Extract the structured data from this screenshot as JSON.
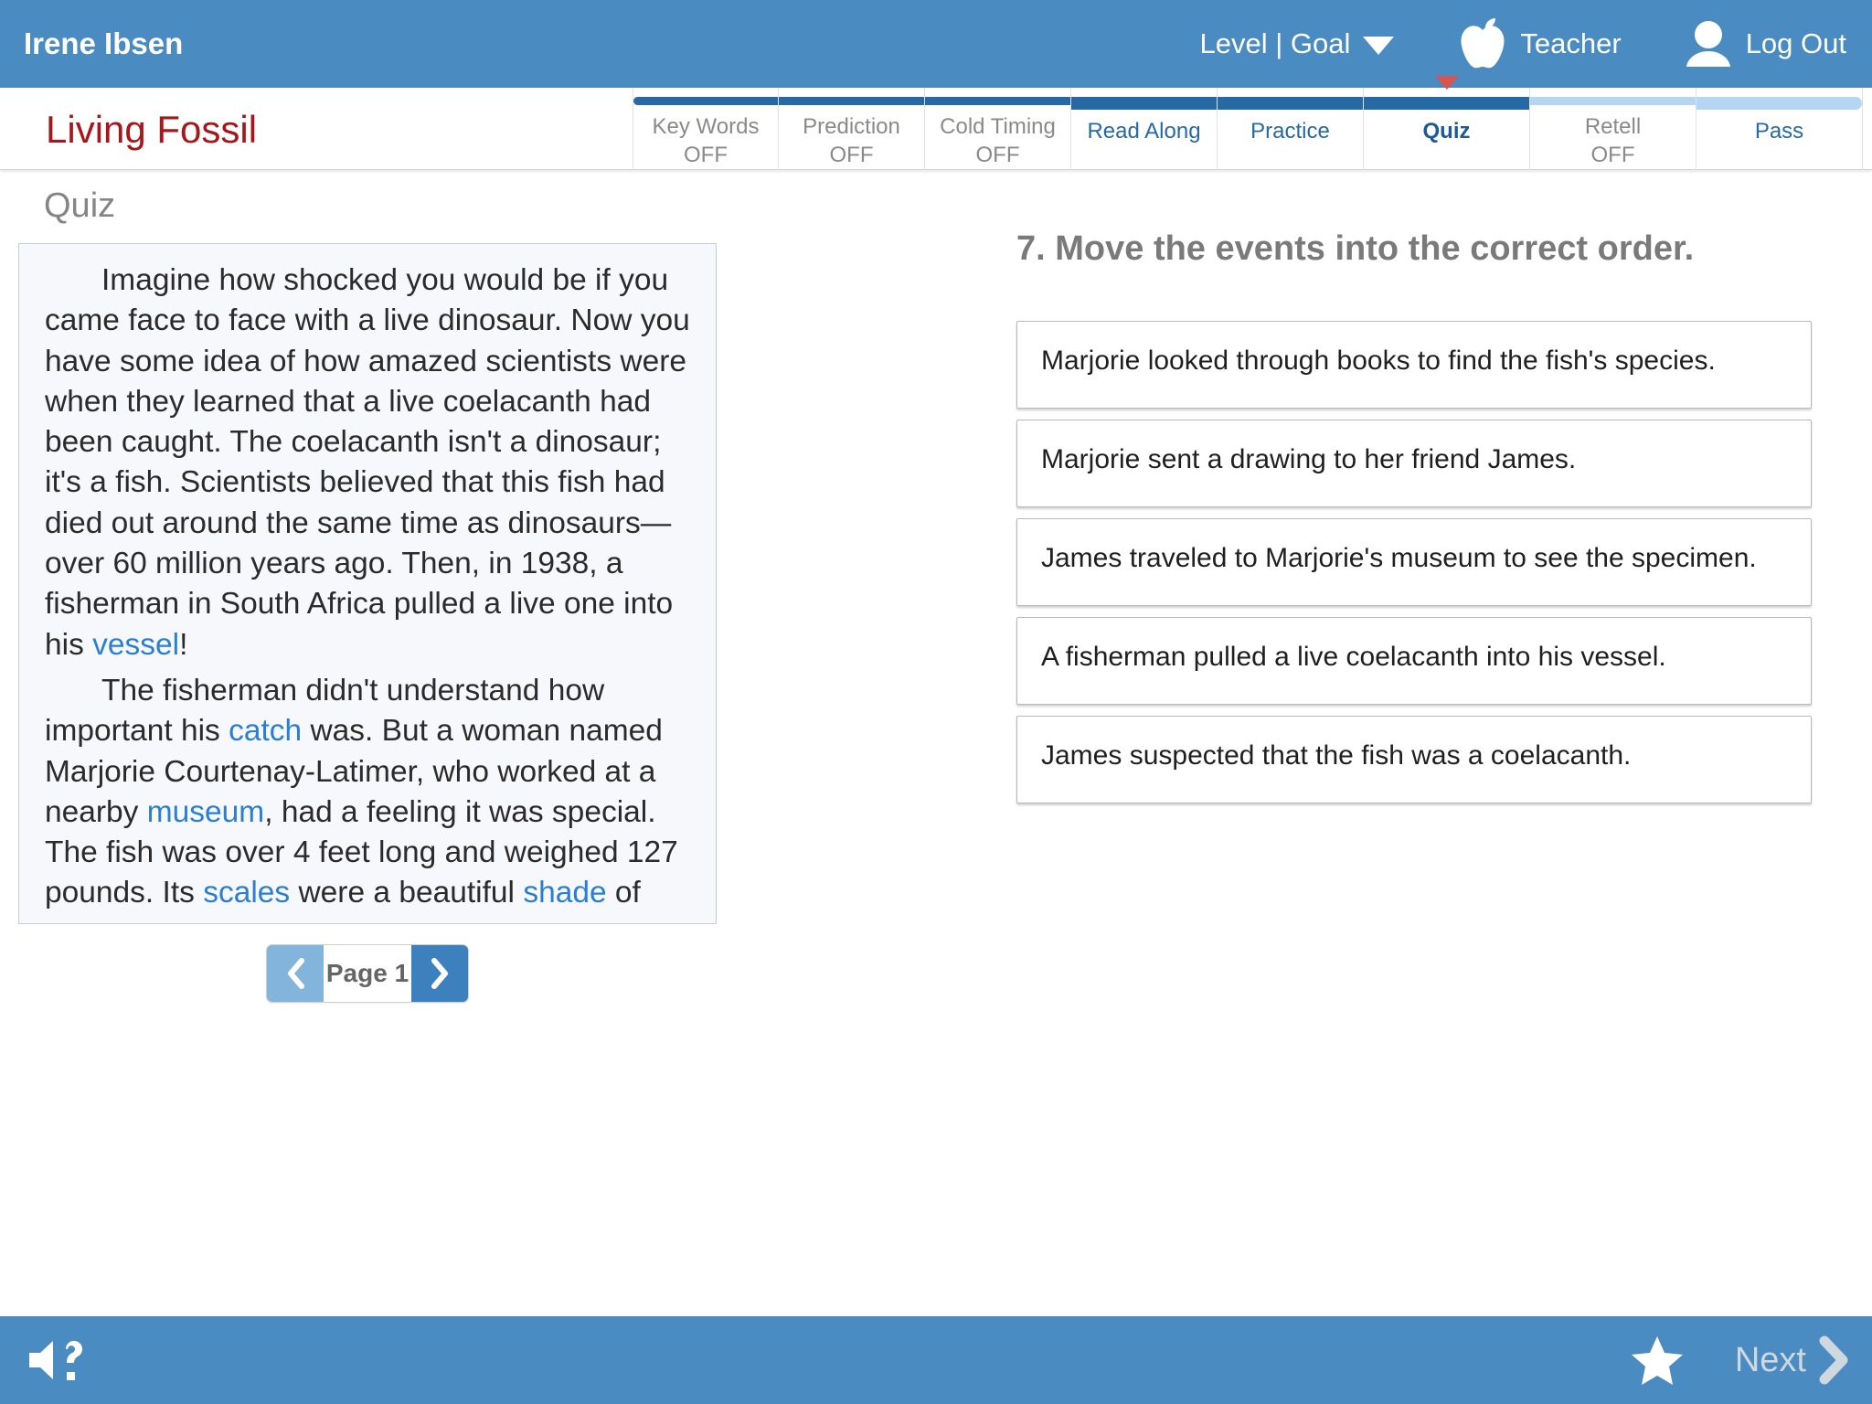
{
  "header": {
    "student_name": "Irene Ibsen",
    "level_goal_label": "Level | Goal",
    "teacher_label": "Teacher",
    "logout_label": "Log Out",
    "accent_color": "#4a8bc2"
  },
  "nav": {
    "book_title": "Living Fossil",
    "title_color": "#a6161b",
    "tabs": [
      {
        "label": "Key Words",
        "status": "OFF",
        "state": "off",
        "bar": "dark"
      },
      {
        "label": "Prediction",
        "status": "OFF",
        "state": "off",
        "bar": "dark"
      },
      {
        "label": "Cold Timing",
        "status": "OFF",
        "state": "off",
        "bar": "dark"
      },
      {
        "label": "Read Along",
        "status": "",
        "state": "on",
        "bar": "dark"
      },
      {
        "label": "Practice",
        "status": "",
        "state": "on",
        "bar": "dark"
      },
      {
        "label": "Quiz",
        "status": "",
        "state": "active",
        "bar": "dark"
      },
      {
        "label": "Retell",
        "status": "OFF",
        "state": "off",
        "bar": "light"
      },
      {
        "label": "Pass",
        "status": "",
        "state": "on",
        "bar": "light"
      }
    ]
  },
  "main": {
    "section_title": "Quiz",
    "passage": {
      "paragraph1": {
        "part1": "Imagine how shocked you would be if you came face to face with a live dinosaur. Now you have some idea of how amazed scientists were when they learned that a live coelacanth had been caught. The coelacanth isn't a dinosaur; it's a fish. Scientists believed that this fish had died out around the same time as dinosaurs—over 60 million years ago. Then, in 1938, a fisherman in South Africa pulled a live one into his ",
        "kw1": "vessel",
        "part2": "!"
      },
      "paragraph2": {
        "part1": "The fisherman didn't understand how important his ",
        "kw1": "catch",
        "part2": " was. But a woman named Marjorie Courtenay-Latimer, who worked at a nearby ",
        "kw2": "museum",
        "part3": ", had a feeling it was special. The fish was over 4 feet long and weighed 127 pounds. Its ",
        "kw3": "scales",
        "part4": " were a beautiful ",
        "kw4": "shade",
        "part5": " of"
      },
      "keyword_color": "#2a7fd4"
    },
    "pager": {
      "page_label": "Page 1",
      "prev_icon": "chevron-left-icon",
      "next_icon": "chevron-right-icon"
    },
    "question": {
      "text": "7. Move the events into the correct order.",
      "events": [
        "Marjorie looked through books to find the fish's species.",
        "Marjorie sent a drawing to her friend James.",
        "James traveled to Marjorie's museum to see the specimen.",
        "A fisherman pulled a live coelacanth into his vessel.",
        "James suspected that the fish was a coelacanth."
      ]
    }
  },
  "footer": {
    "help_icon": "speaker-question-icon",
    "star_icon": "star-icon",
    "next_label": "Next",
    "next_icon": "chevron-right-icon"
  }
}
